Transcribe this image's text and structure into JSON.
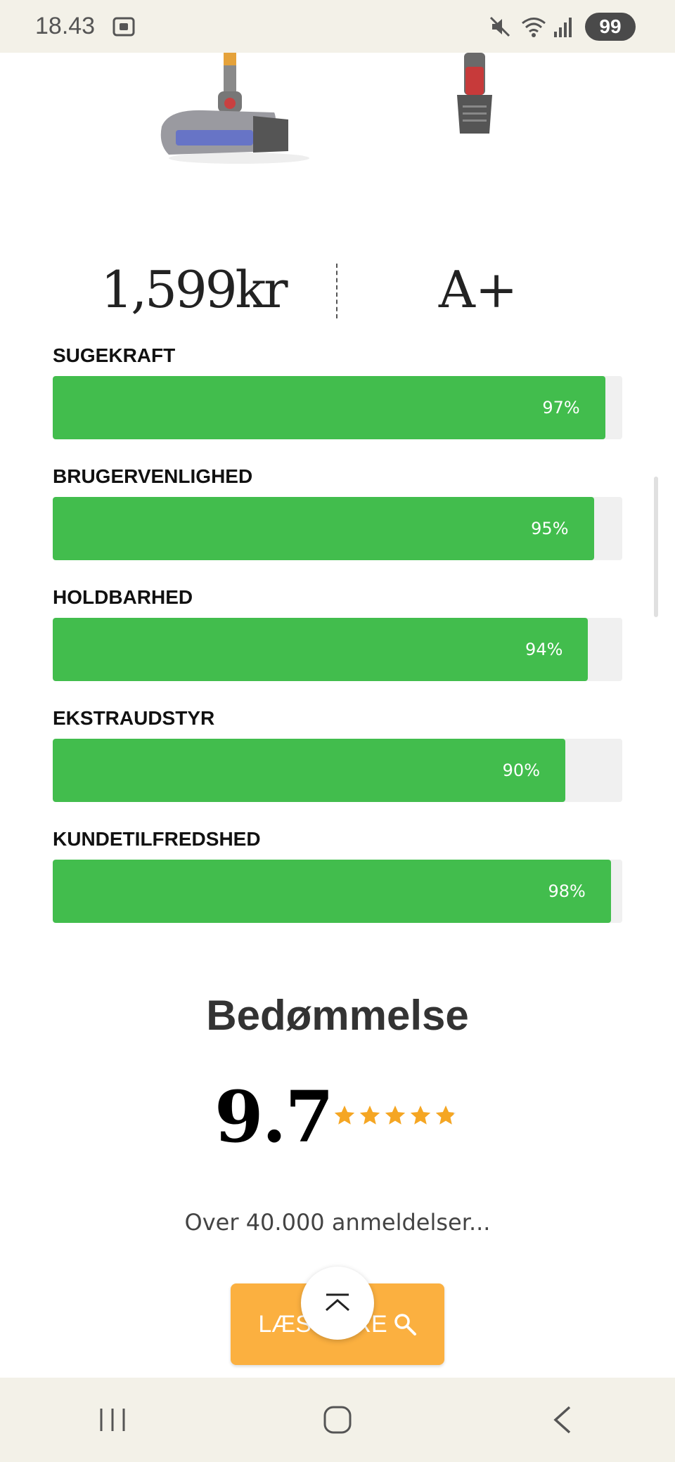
{
  "status_bar": {
    "time": "18.43",
    "battery": "99",
    "icons": [
      "screen-record-icon",
      "mute-icon",
      "wifi-icon",
      "signal-icon"
    ]
  },
  "product": {
    "price": "1,599kr",
    "grade": "A+"
  },
  "metrics": [
    {
      "label": "SUGEKRAFT",
      "value": "97%",
      "percent": 97
    },
    {
      "label": "BRUGERVENLIGHED",
      "value": "95%",
      "percent": 95
    },
    {
      "label": "HOLDBARHED",
      "value": "94%",
      "percent": 94
    },
    {
      "label": "EKSTRAUDSTYR",
      "value": "90%",
      "percent": 90
    },
    {
      "label": "KUNDETILFREDSHED",
      "value": "98%",
      "percent": 98
    }
  ],
  "rating": {
    "title": "Bedømmelse",
    "score": "9.7",
    "stars": 4.85,
    "reviews": "Over 40.000 anmeldelser..."
  },
  "cta": {
    "label": "LÆS MERE"
  },
  "colors": {
    "bar_fill": "#42bd4d",
    "bar_track": "#f0f0f0",
    "cta": "#fbb040",
    "star": "#f5a623"
  }
}
